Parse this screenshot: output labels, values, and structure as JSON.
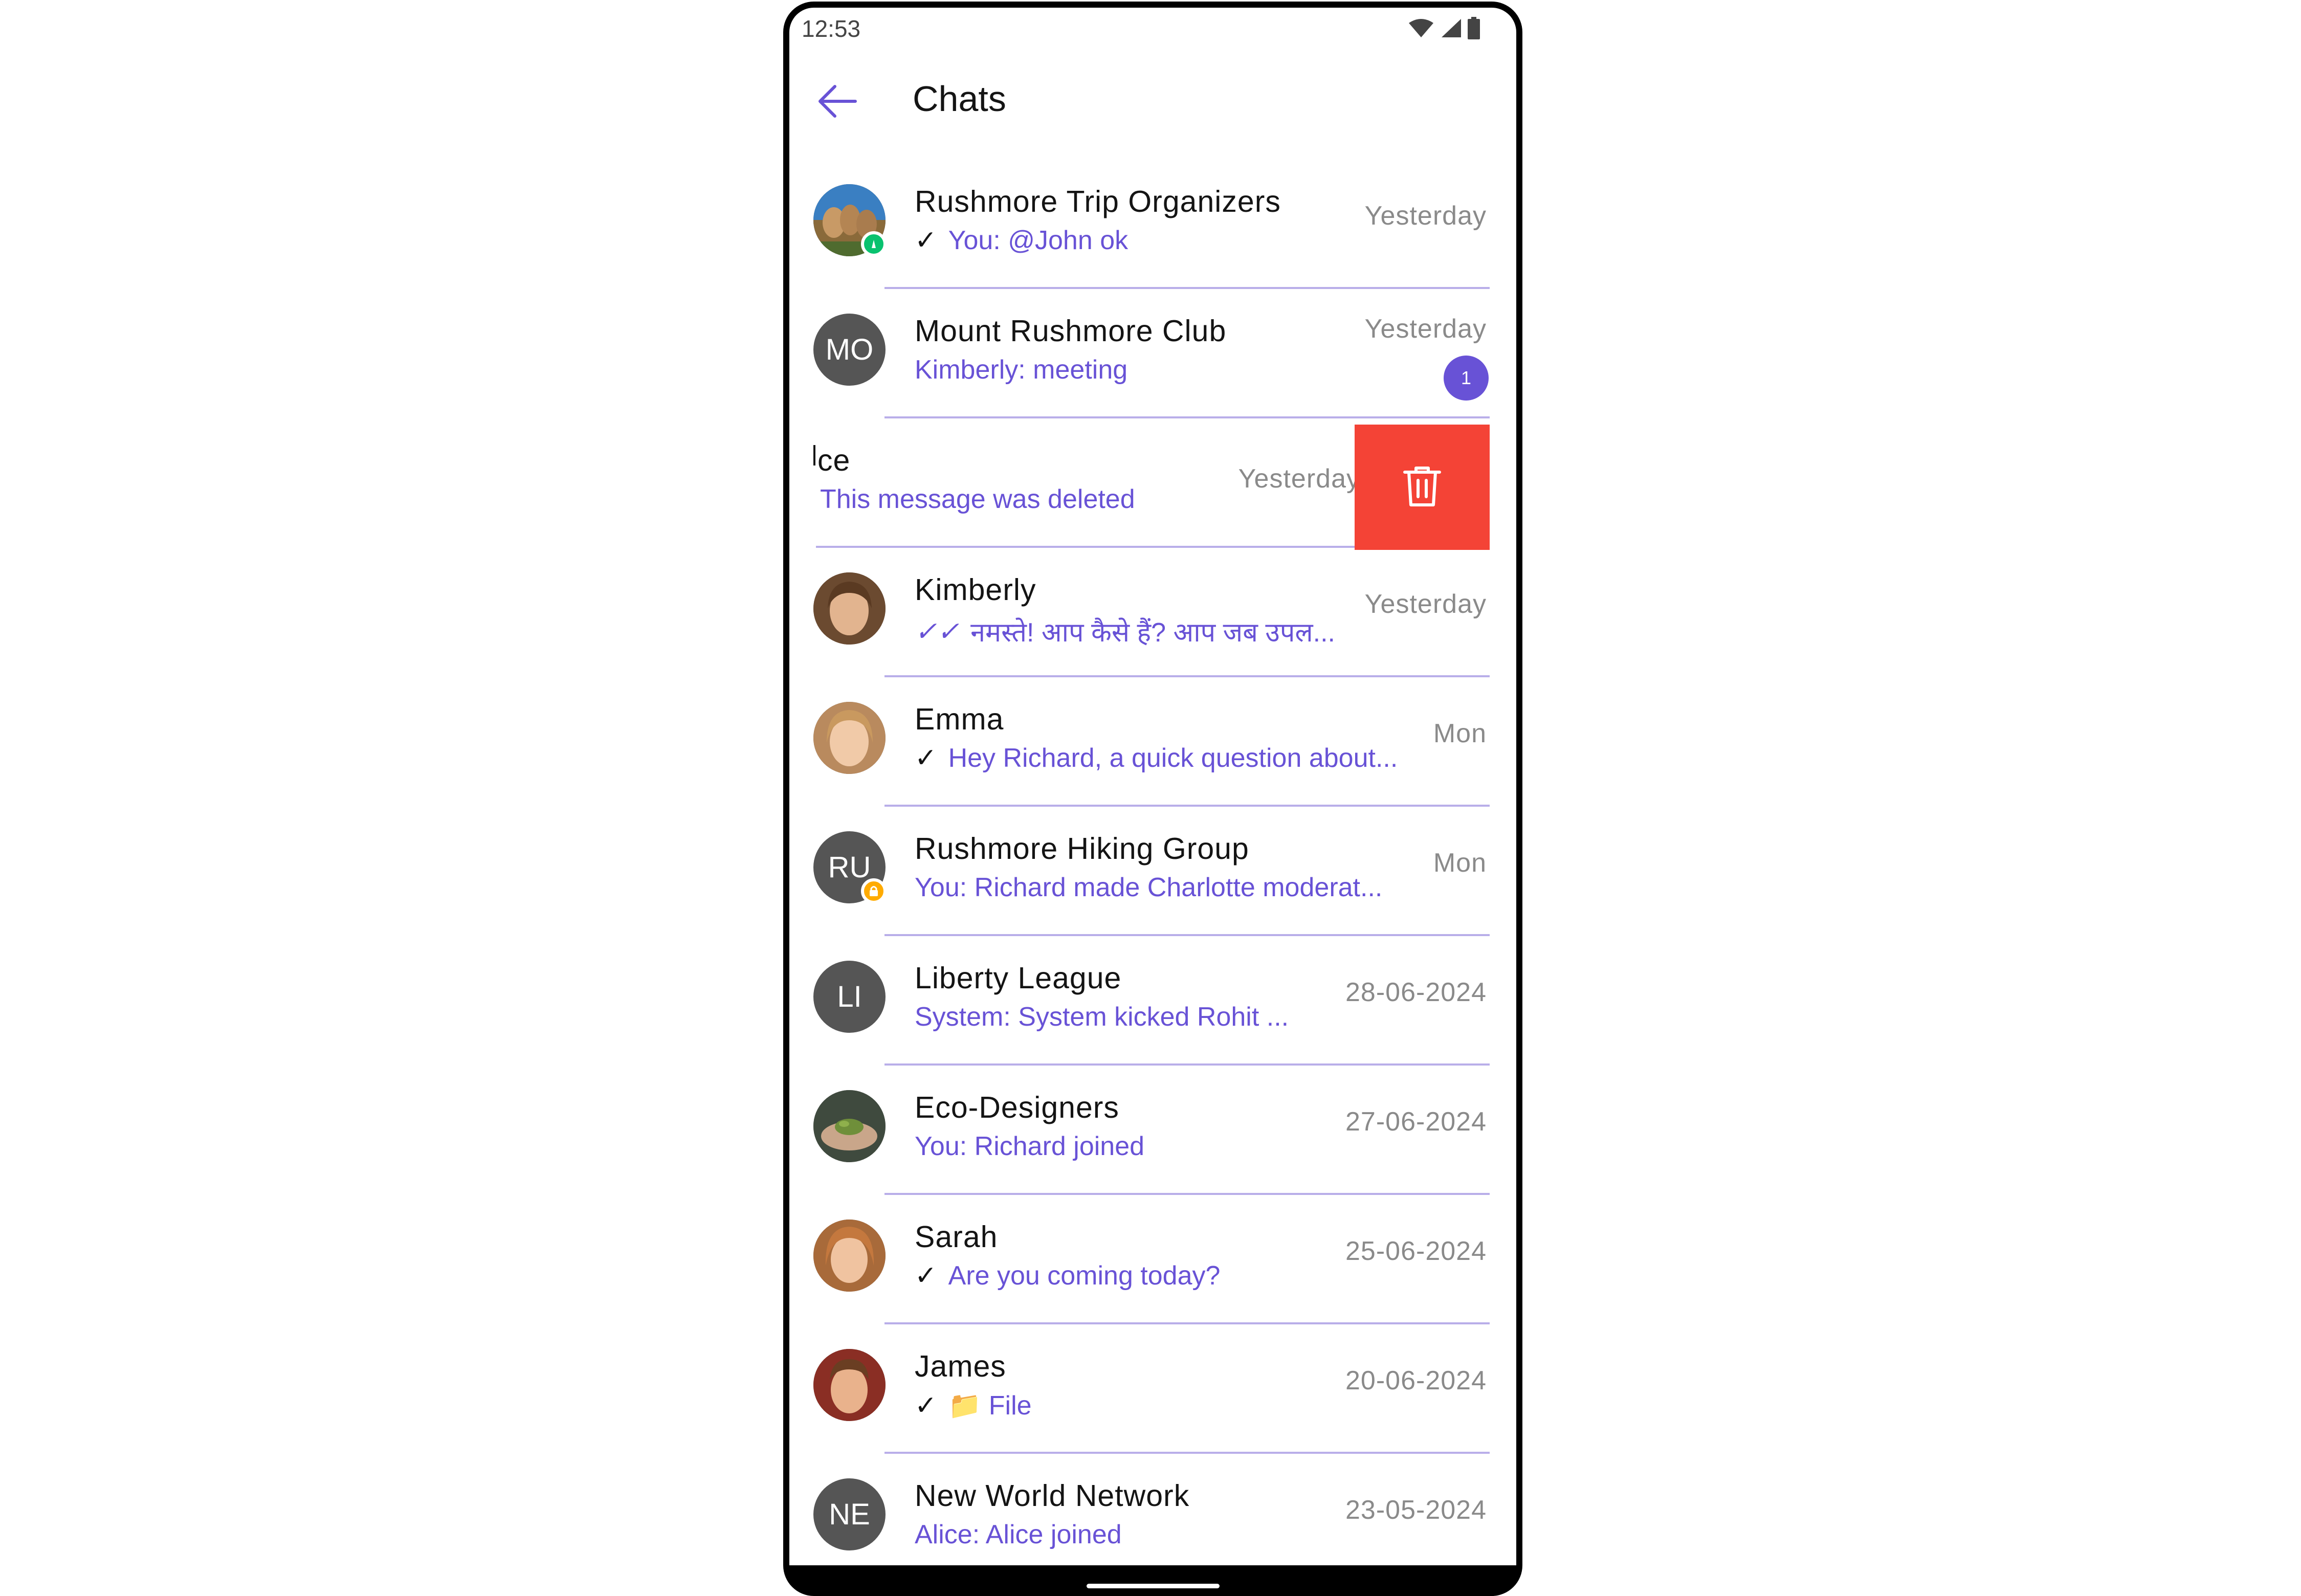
{
  "status_bar": {
    "time": "12:53"
  },
  "header": {
    "title": "Chats"
  },
  "colors": {
    "accent": "#6852d6",
    "delete": "#f44336",
    "divider": "#b9aee9",
    "online": "#09c26f",
    "private": "#ffab00"
  },
  "chats": [
    {
      "name": "Rushmore Trip Organizers",
      "preview": "You: @John ok",
      "tick": "✓",
      "time": "Yesterday",
      "avatar": "photo-mountain",
      "badge": "online"
    },
    {
      "name": "Mount Rushmore Club",
      "preview": "Kimberly: meeting",
      "time": "Yesterday",
      "initials": "MO",
      "unread": "1"
    },
    {
      "name": "ce",
      "preview": "This message was deleted",
      "time": "Yesterday"
    },
    {
      "name": "Kimberly",
      "preview": "नमस्ते! आप कैसे हैं?  आप जब उपल...",
      "tick": "✓✓",
      "time": "Yesterday",
      "avatar": "photo-woman"
    },
    {
      "name": "Emma",
      "preview": "Hey Richard, a quick question about...",
      "tick": "✓",
      "time": "Mon",
      "avatar": "photo-woman"
    },
    {
      "name": "Rushmore Hiking Group",
      "preview": "You: Richard made Charlotte moderat...",
      "time": "Mon",
      "initials": "RU",
      "badge": "private"
    },
    {
      "name": "Liberty League",
      "preview": "System: System kicked Rohit ...",
      "time": "28-06-2024",
      "initials": "LI"
    },
    {
      "name": "Eco-Designers",
      "preview": "You: Richard joined",
      "time": "27-06-2024",
      "avatar": "photo-plant"
    },
    {
      "name": "Sarah",
      "preview": "Are you coming today?",
      "tick": "✓",
      "time": "25-06-2024",
      "avatar": "photo-woman"
    },
    {
      "name": "James",
      "preview": "📁 File",
      "tick": "✓",
      "time": "20-06-2024",
      "avatar": "photo-man"
    },
    {
      "name": "New World Network",
      "preview": "Alice: Alice joined",
      "time": "23-05-2024",
      "initials": "NE"
    }
  ]
}
